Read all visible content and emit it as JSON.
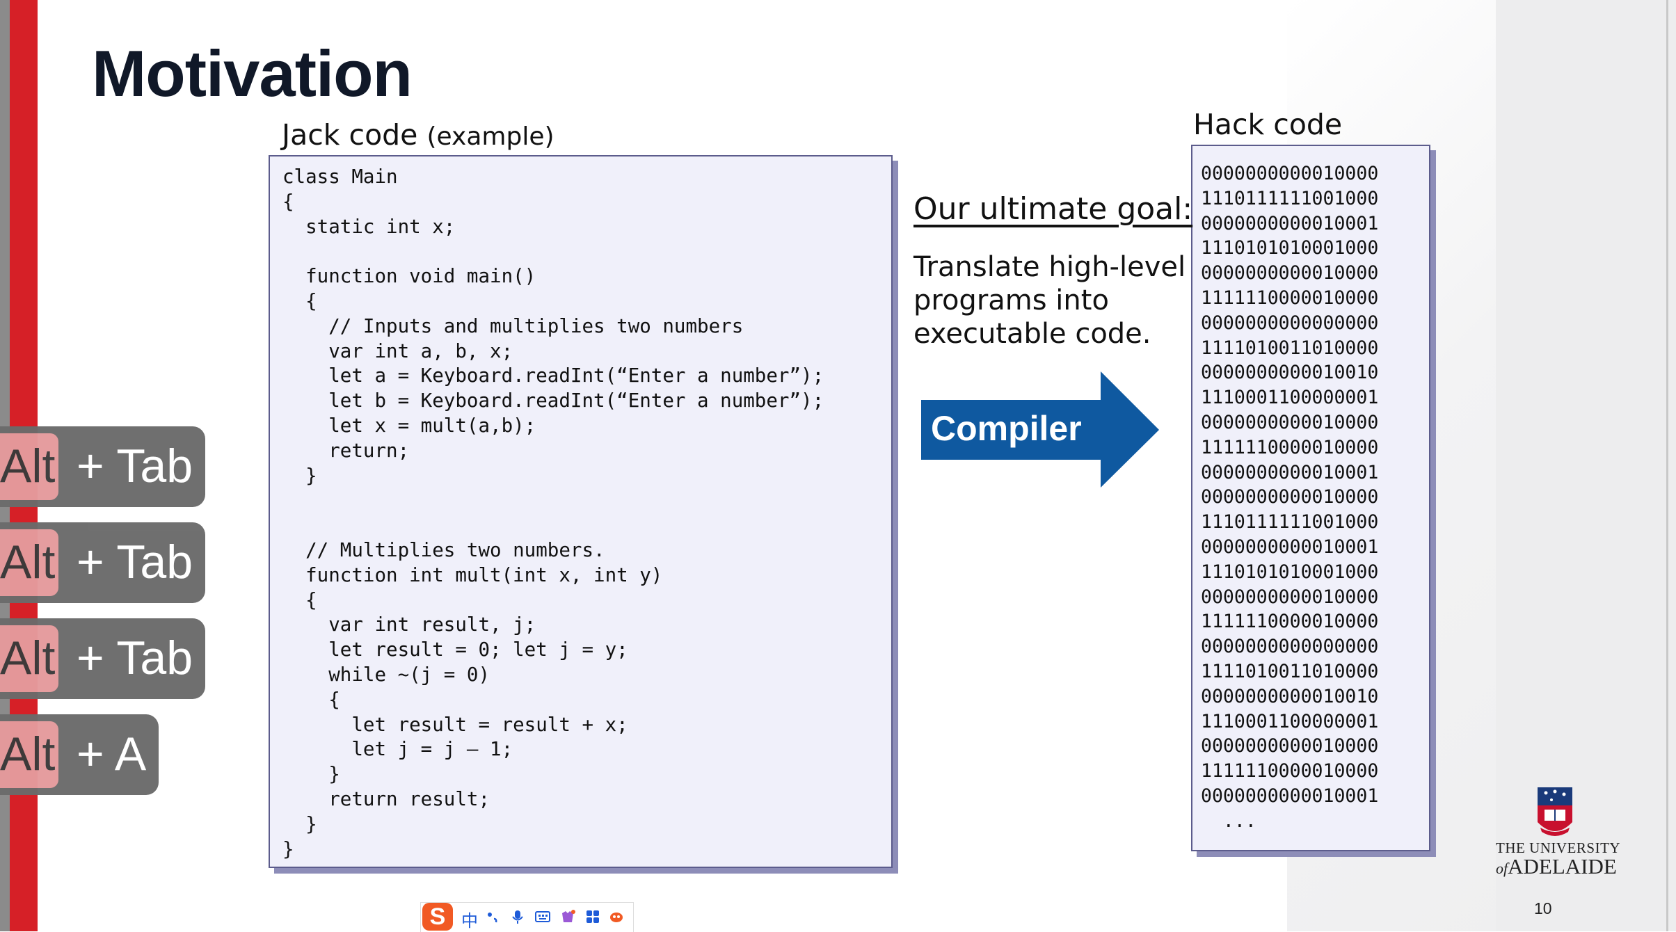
{
  "slide": {
    "title": "Motivation",
    "page_number": "10"
  },
  "jack": {
    "label": "Jack code",
    "label_suffix": "(example)",
    "code": "class Main\n{\n  static int x;\n\n  function void main()\n  {\n    // Inputs and multiplies two numbers\n    var int a, b, x;\n    let a = Keyboard.readInt(“Enter a number”);\n    let b = Keyboard.readInt(“Enter a number”);\n    let x = mult(a,b);\n    return;\n  }\n\n\n  // Multiplies two numbers.\n  function int mult(int x, int y)\n  {\n    var int result, j;\n    let result = 0; let j = y;\n    while ~(j = 0)\n    {\n      let result = result + x;\n      let j = j – 1;\n    }\n    return result;\n  }\n}"
  },
  "hack": {
    "label": "Hack code",
    "code": "0000000000010000\n1110111111001000\n0000000000010001\n1110101010001000\n0000000000010000\n1111110000010000\n0000000000000000\n1111010011010000\n0000000000010010\n1110001100000001\n0000000000010000\n1111110000010000\n0000000000010001\n0000000000010000\n1110111111001000\n0000000000010001\n1110101010001000\n0000000000010000\n1111110000010000\n0000000000000000\n1111010011010000\n0000000000010010\n1110001100000001\n0000000000010000\n1111110000010000\n0000000000010001\n  ..."
  },
  "goal": {
    "title": "Our ultimate goal:",
    "text": "Translate high-level programs into executable code."
  },
  "compiler": {
    "label": "Compiler",
    "color": "#0f59a0"
  },
  "shortcut_hints": [
    {
      "key": "Alt",
      "rest": "+ Tab"
    },
    {
      "key": "Alt",
      "rest": "+ Tab"
    },
    {
      "key": "Alt",
      "rest": "+ Tab"
    },
    {
      "key": "Alt",
      "rest": "+ A"
    }
  ],
  "university": {
    "line1": "THE UNIVERSITY",
    "of": "of",
    "line2": "ADELAIDE"
  },
  "ime_toolbar": {
    "logo": "S",
    "language": "中",
    "icons": [
      "punctuation-icon",
      "microphone-icon",
      "keyboard-icon",
      "skin-icon",
      "apps-grid-icon",
      "mascot-icon"
    ]
  },
  "colors": {
    "accent_red": "#d62027",
    "code_bg": "#f0f0fa",
    "title": "#101828"
  }
}
